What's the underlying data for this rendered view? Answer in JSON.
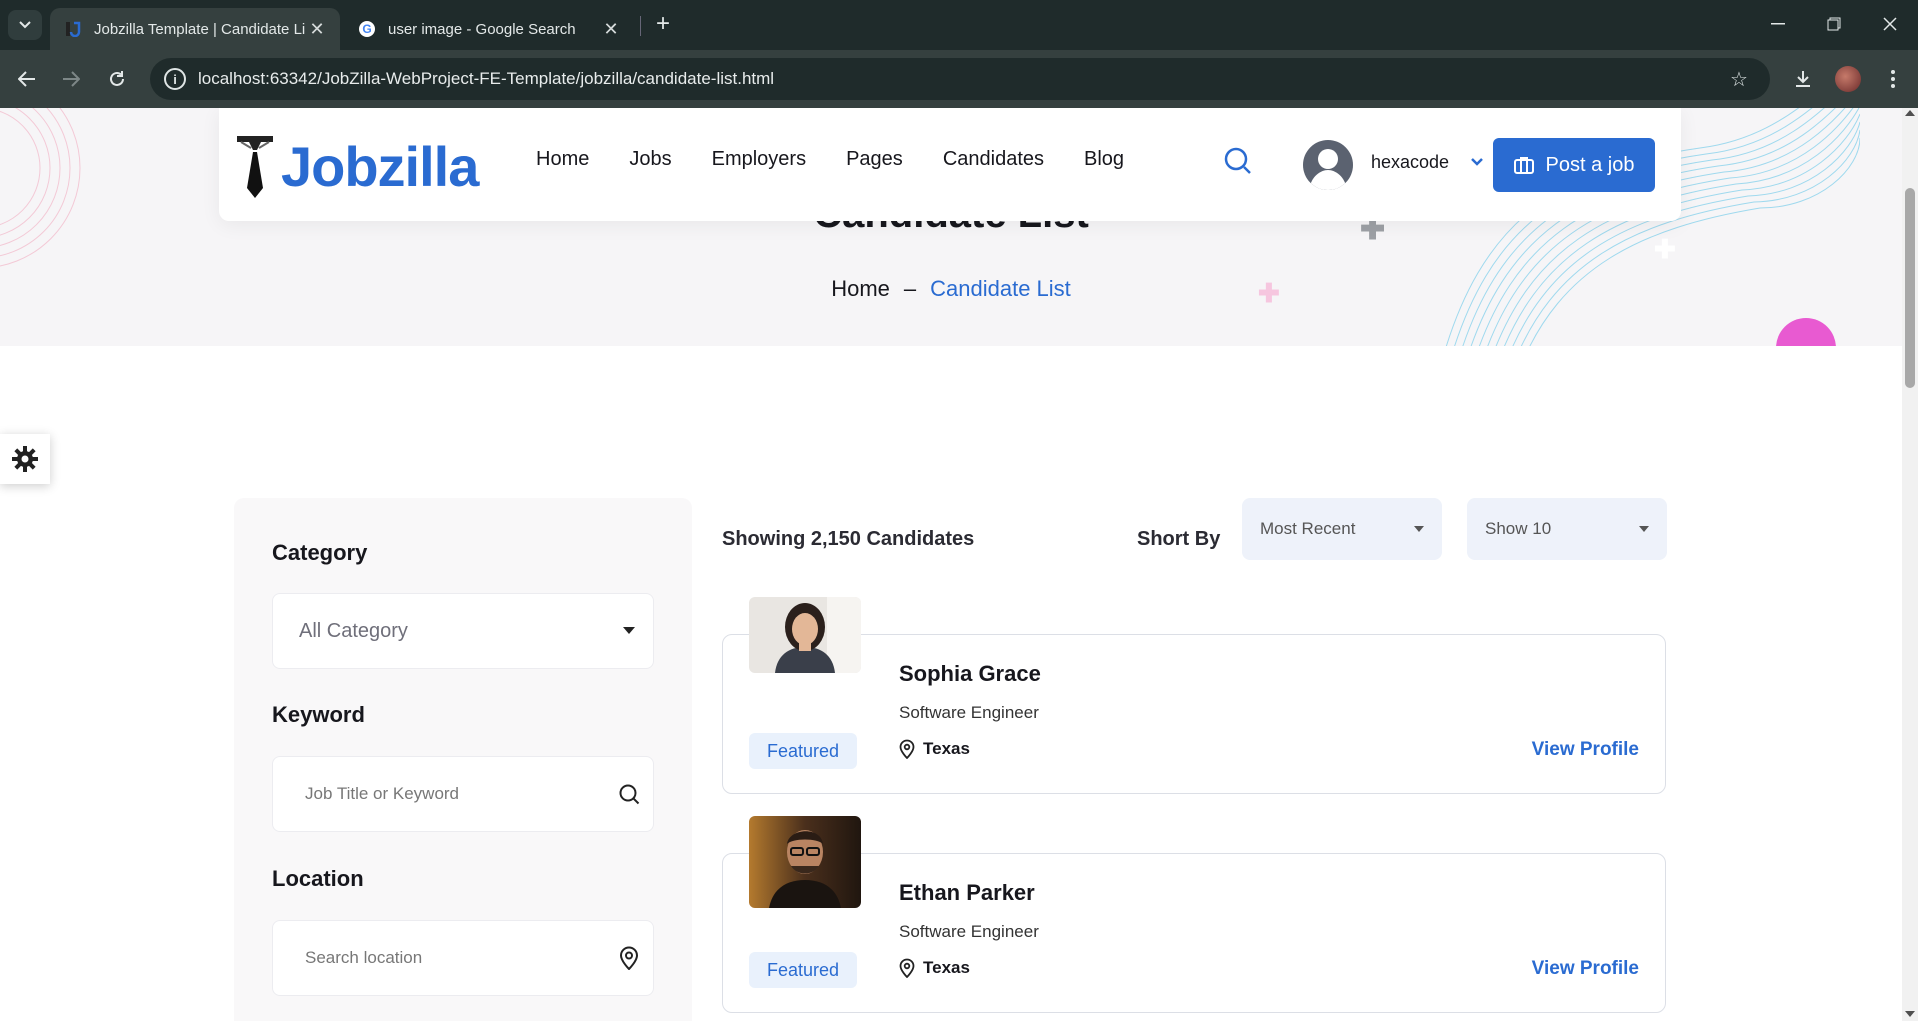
{
  "browser": {
    "tabs": [
      {
        "title": "Jobzilla Template | Candidate Li",
        "active": true
      },
      {
        "title": "user image - Google Search",
        "active": false
      }
    ],
    "url": "localhost:63342/JobZilla-WebProject-FE-Template/jobzilla/candidate-list.html"
  },
  "header": {
    "logo_text": "Jobzilla",
    "menu": [
      "Home",
      "Jobs",
      "Employers",
      "Pages",
      "Candidates",
      "Blog"
    ],
    "username": "hexacode",
    "post_job_label": "Post a job"
  },
  "banner": {
    "title": "Candidate List",
    "breadcrumb_home": "Home",
    "breadcrumb_sep": "–",
    "breadcrumb_current": "Candidate List"
  },
  "sidebar": {
    "category_label": "Category",
    "category_value": "All Category",
    "keyword_label": "Keyword",
    "keyword_placeholder": "Job Title or Keyword",
    "location_label": "Location",
    "location_placeholder": "Search location"
  },
  "results": {
    "showing": "Showing 2,150 Candidates",
    "sort_label": "Short By",
    "sort_value": "Most Recent",
    "show_value": "Show 10"
  },
  "candidates": [
    {
      "name": "Sophia Grace",
      "role": "Software Engineer",
      "location": "Texas",
      "badge": "Featured",
      "action": "View Profile"
    },
    {
      "name": "Ethan Parker",
      "role": "Software Engineer",
      "location": "Texas",
      "badge": "Featured",
      "action": "View Profile"
    }
  ],
  "colors": {
    "accent": "#2a6bd1",
    "badge_bg": "#e9f1fc",
    "chrome_dark": "#1f2b2b"
  }
}
